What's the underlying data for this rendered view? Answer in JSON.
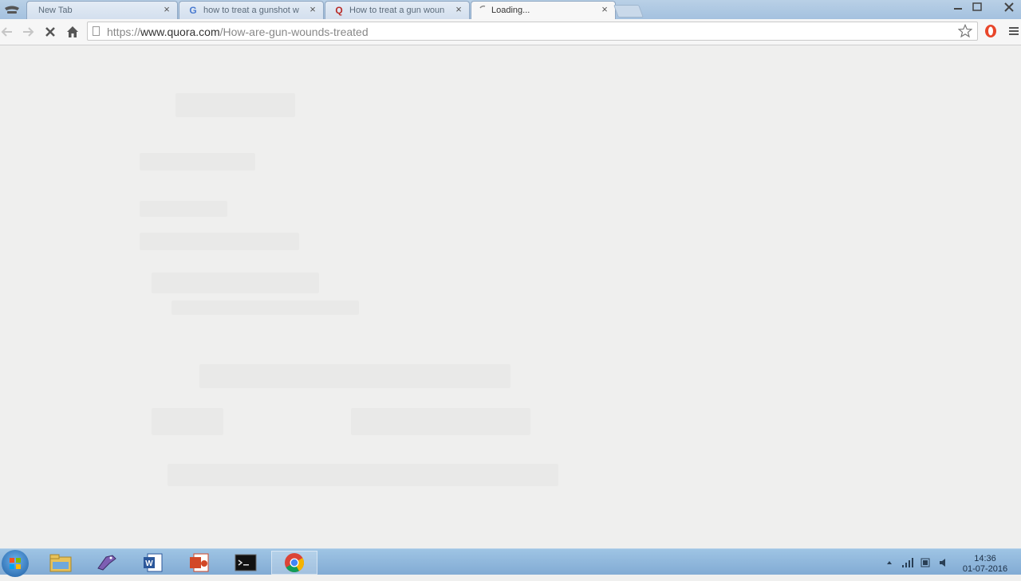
{
  "browser": {
    "tabs": [
      {
        "title": "New Tab",
        "favicon": "none",
        "active": false
      },
      {
        "title": "how to treat a gunshot w",
        "favicon": "google-icon",
        "active": false
      },
      {
        "title": "How to treat a gun woun",
        "favicon": "quora-icon",
        "active": false
      },
      {
        "title": "Loading...",
        "favicon": "loading-spinner-icon",
        "active": true
      }
    ],
    "tab_close_glyph": "×",
    "window_buttons": [
      "minimize-icon",
      "maximize-icon",
      "close-icon"
    ]
  },
  "toolbar": {
    "back": "back-arrow-icon",
    "forward": "forward-arrow-icon",
    "stop": "stop-x-icon",
    "home": "home-icon",
    "url_scheme": "https://",
    "url_host": "www.quora.com",
    "url_path": "/How-are-gun-wounds-treated",
    "bookmark": "star-icon",
    "extension": "opera-icon",
    "menu": "hamburger-menu-icon"
  },
  "taskbar": {
    "apps": [
      "windows-explorer-icon",
      "pidgin-icon",
      "word-icon",
      "powerpoint-icon",
      "command-prompt-icon",
      "chrome-icon"
    ],
    "active_app": "chrome-icon",
    "clock_time": "14:36",
    "clock_date": "01-07-2016"
  },
  "colors": {
    "tab_strip": "#a9c4e0",
    "content_bg": "#efefee",
    "taskbar": "#8fb6dc"
  }
}
